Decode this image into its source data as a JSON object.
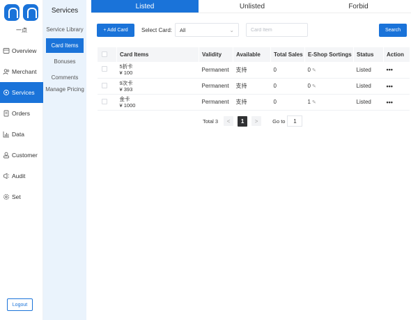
{
  "app": {
    "logo_text": "一点"
  },
  "sidebar": {
    "items": [
      {
        "label": "Overview",
        "icon": "overview-icon",
        "active": false
      },
      {
        "label": "Merchant",
        "icon": "merchant-icon",
        "active": false
      },
      {
        "label": "Services",
        "icon": "services-icon",
        "active": true
      },
      {
        "label": "Orders",
        "icon": "orders-icon",
        "active": false
      },
      {
        "label": "Data",
        "icon": "data-icon",
        "active": false
      },
      {
        "label": "Customer",
        "icon": "customer-icon",
        "active": false
      },
      {
        "label": "Audit",
        "icon": "audit-icon",
        "active": false
      },
      {
        "label": "Set",
        "icon": "gear-icon",
        "active": false
      }
    ],
    "logout_label": "Logout"
  },
  "subnav": {
    "title": "Services",
    "items": [
      {
        "label": "Service Library",
        "active": false
      },
      {
        "label": "Card Items",
        "active": true
      },
      {
        "label": "Bonuses",
        "active": false
      },
      {
        "label": "Comments",
        "active": false
      },
      {
        "label": "Manage Pricing",
        "active": false
      }
    ]
  },
  "tabs": [
    {
      "label": "Listed",
      "active": true
    },
    {
      "label": "Unlisted",
      "active": false
    },
    {
      "label": "Forbid",
      "active": false
    }
  ],
  "toolbar": {
    "add_label": "+ Add Card",
    "select_label": "Select Card:",
    "select_value": "All",
    "search_placeholder": "Card Item",
    "search_button": "Search"
  },
  "table": {
    "columns": [
      "Card Items",
      "Validity",
      "Available",
      "Total Sales",
      "E-Shop Sortings",
      "Status",
      "Action"
    ],
    "rows": [
      {
        "name": "5折卡",
        "price": "¥ 100",
        "validity": "Permanent",
        "available": "支持",
        "total_sales": "0",
        "sorting": "0",
        "status": "Listed",
        "action": "•••"
      },
      {
        "name": "9次卡",
        "price": "¥ 393",
        "validity": "Permanent",
        "available": "支持",
        "total_sales": "0",
        "sorting": "0",
        "status": "Listed",
        "action": "•••"
      },
      {
        "name": "金卡",
        "price": "¥ 1000",
        "validity": "Permanent",
        "available": "支持",
        "total_sales": "0",
        "sorting": "1",
        "status": "Listed",
        "action": "•••"
      }
    ]
  },
  "pagination": {
    "total_text": "Total 3",
    "prev": "<",
    "current_page": "1",
    "next": ">",
    "goto_label": "Go to",
    "goto_value": "1"
  },
  "colors": {
    "primary": "#1a73d9",
    "subnav_bg": "#eaf3fc"
  }
}
